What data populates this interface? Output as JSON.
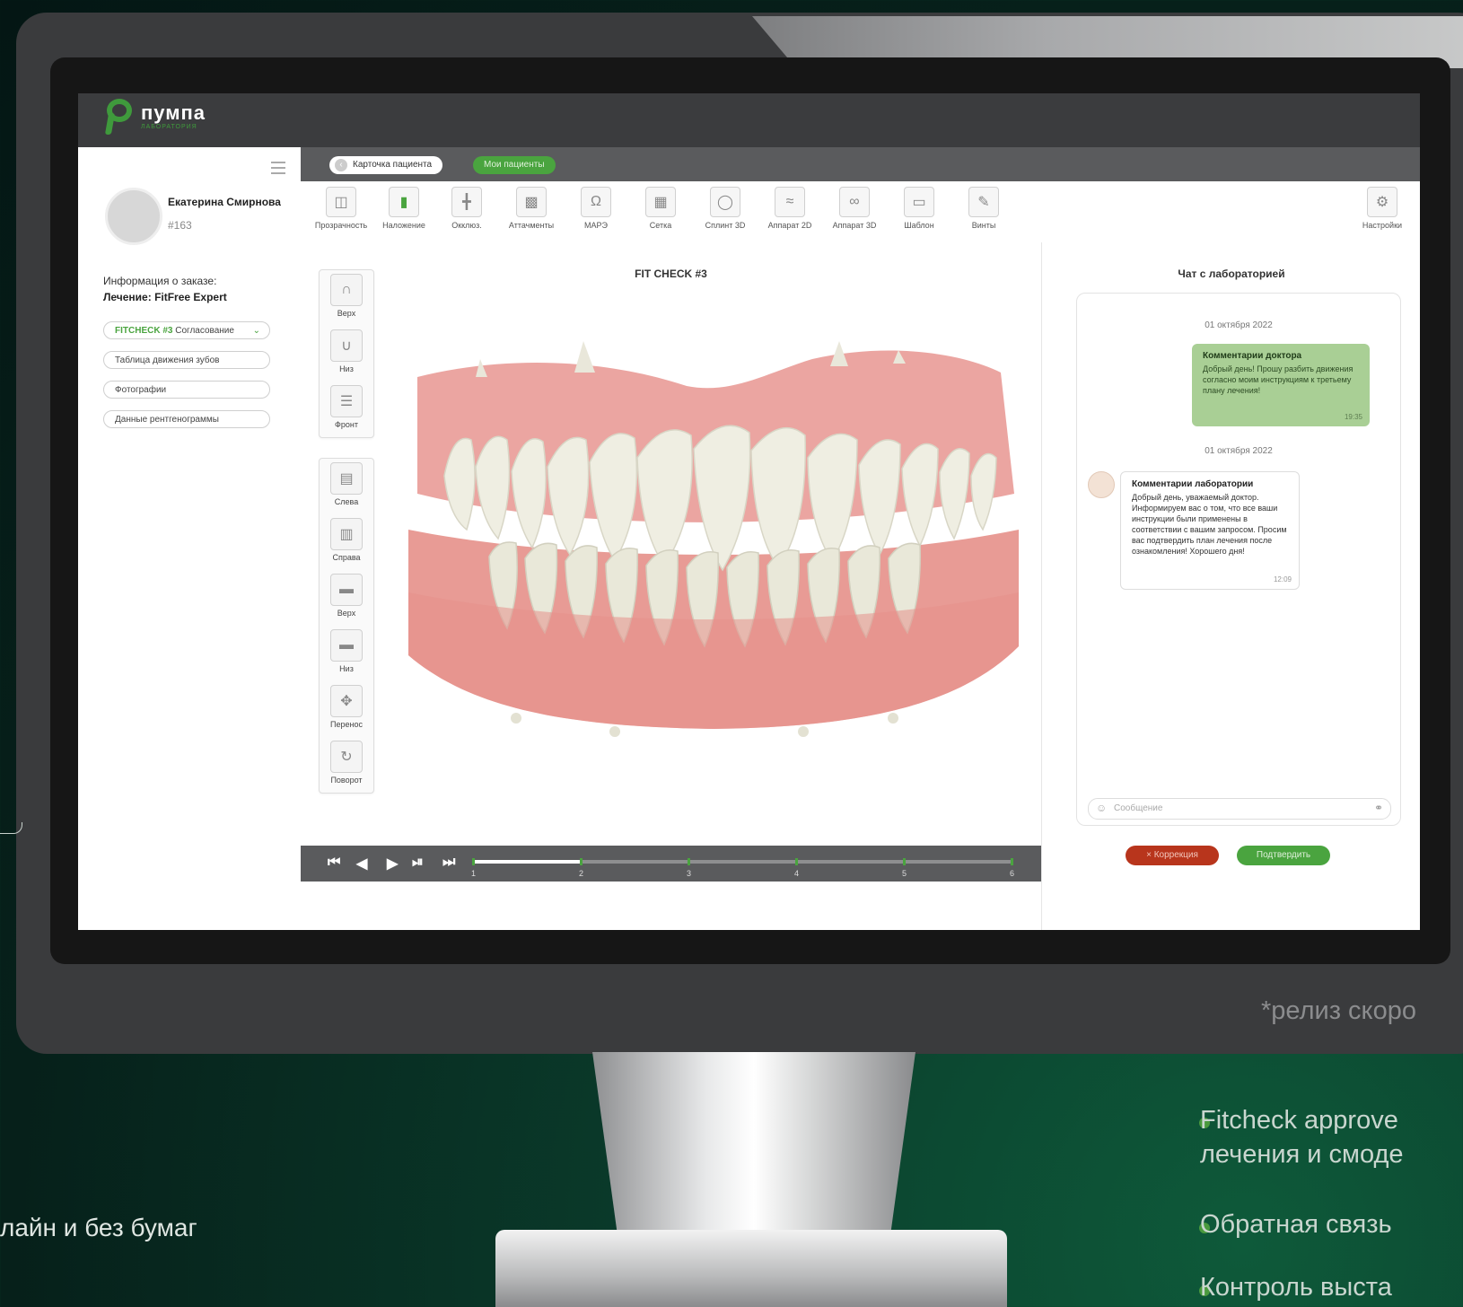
{
  "app": {
    "name": "пумпа",
    "sub": "ЛАБОРАТОРИЯ"
  },
  "patient": {
    "name": "Екатерина Смирнова",
    "id": "#163"
  },
  "order": {
    "label": "Информация о заказе:",
    "treatment": "Лечение: FitFree Expert",
    "fitcheck_tag": "FITCHECK #3",
    "fitcheck_status": "Согласование",
    "links": [
      "Таблица движения зубов",
      "Фотографии",
      "Данные рентгенограммы"
    ]
  },
  "tabs": {
    "patient_card": "Карточка пациента",
    "my_patients": "Мои пациенты"
  },
  "toolbar": {
    "tools": [
      {
        "label": "Прозрачность",
        "icon": "transparency-icon"
      },
      {
        "label": "Наложение",
        "icon": "overlay-icon"
      },
      {
        "label": "Окклюз.",
        "icon": "occlusion-icon"
      },
      {
        "label": "Аттачменты",
        "icon": "attachments-icon"
      },
      {
        "label": "МАРЭ",
        "icon": "mare-icon"
      },
      {
        "label": "Сетка",
        "icon": "grid-icon"
      },
      {
        "label": "Сплинт 3D",
        "icon": "splint-icon"
      },
      {
        "label": "Аппарат 2D",
        "icon": "apparatus-2d-icon"
      },
      {
        "label": "Аппарат 3D",
        "icon": "apparatus-3d-icon"
      },
      {
        "label": "Шаблон",
        "icon": "template-icon"
      },
      {
        "label": "Винты",
        "icon": "screws-icon"
      }
    ],
    "settings": "Настройки"
  },
  "viewer": {
    "title": "FIT CHECK #3",
    "view_tools": [
      "Верх",
      "Низ",
      "Фронт"
    ],
    "side_tools": [
      "Слева",
      "Справа",
      "Верх",
      "Низ",
      "Перенос",
      "Поворот"
    ]
  },
  "player": {
    "steps": [
      "1",
      "2",
      "3",
      "4",
      "5",
      "6"
    ],
    "progress": 0.2
  },
  "chat": {
    "title": "Чат с лабораторией",
    "date1": "01 октября 2022",
    "doctor_msg": {
      "title": "Комментарии доктора",
      "text": "Добрый день! Прошу разбить движения согласно моим инструкциям к третьему плану лечения!",
      "time": "19:35"
    },
    "date2": "01 октября 2022",
    "lab_msg": {
      "title": "Комментарии лаборатории",
      "text": "Добрый день, уважаемый доктор. Информируем вас о том, что все ваши инструкции были применены в соответствии с вашим запросом. Просим вас подтвердить план лечения после ознакомления! Хорошего дня!",
      "time": "12:09"
    },
    "input_placeholder": "Сообщение",
    "correction": "Коррекция",
    "confirm": "Подтвердить"
  },
  "release_note": "*релиз скоро",
  "bullets": [
    "Fitcheck approve",
    "лечения и смоде",
    "Обратная связь",
    "Контроль выста"
  ],
  "bottom_left": "лайн и без бумаг",
  "colors": {
    "accent": "#4aa43f",
    "danger": "#b8351c",
    "gum": "#e89590",
    "tooth": "#efeee2"
  }
}
